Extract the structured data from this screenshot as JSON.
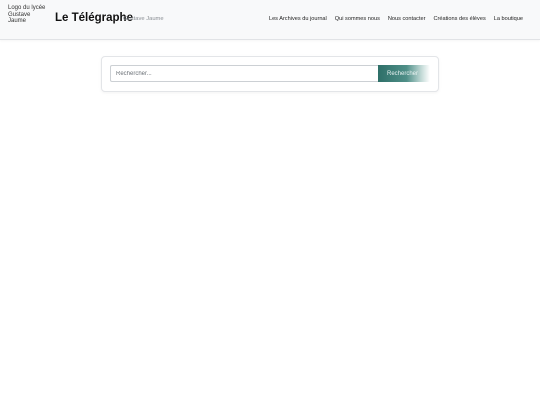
{
  "header": {
    "logo_alt": "Logo du lycée Gustave Jaume",
    "title": "Le Télégraphe",
    "subtitle": "Gustave Jaume",
    "nav": [
      {
        "label": "Les Archives du journal"
      },
      {
        "label": "Qui sommes nous"
      },
      {
        "label": "Nous contacter"
      },
      {
        "label": "Créations des élèves"
      },
      {
        "label": "La boutique"
      }
    ]
  },
  "search": {
    "placeholder": "Rechercher...",
    "value": "",
    "button_label": "Rechercher"
  },
  "colors": {
    "header_bg": "#f8f9fa",
    "accent": "#2e6f68"
  }
}
